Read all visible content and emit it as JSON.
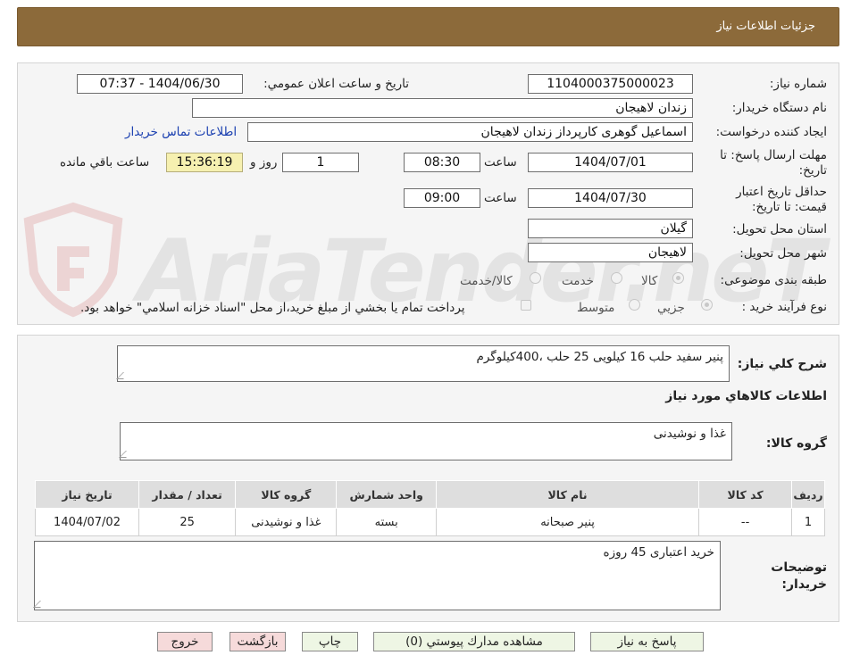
{
  "header": {
    "title": "جزئیات اطلاعات نیاز"
  },
  "form": {
    "need_number": {
      "label": "شماره نیاز:",
      "value": "1104000375000023"
    },
    "announce_datetime": {
      "label": "تاریخ و ساعت اعلان عمومي:",
      "value": "1404/06/30 - 07:37"
    },
    "buyer_org": {
      "label": "نام دستگاه خريدار:",
      "value": "زندان لاهيجان"
    },
    "requester": {
      "label": "ايجاد كننده درخواست:",
      "value": "اسماعیل گوهری کارپرداز زندان لاهیجان"
    },
    "contact_link": "اطلاعات تماس خريدار",
    "deadline": {
      "label_line1": "مهلت ارسال پاسخ: تا",
      "label_line2": "تاريخ:",
      "date": "1404/07/01",
      "time_label": "ساعت",
      "time": "08:30",
      "days": "1",
      "days_label": "روز و",
      "remaining": "15:36:19",
      "remaining_label": "ساعت باقي مانده"
    },
    "price_validity": {
      "label_line1": "حداقل تاريخ اعتبار",
      "label_line2": "قيمت: تا تاريخ:",
      "date": "1404/07/30",
      "time_label": "ساعت",
      "time": "09:00"
    },
    "province": {
      "label": "استان محل تحويل:",
      "value": "گيلان"
    },
    "city": {
      "label": "شهر محل تحويل:",
      "value": "لاهيجان"
    },
    "category": {
      "label": "طبقه بندی موضوعی:",
      "options": [
        "کالا",
        "خدمت",
        "کالا/خدمت"
      ],
      "selected": 0
    },
    "purchase_process": {
      "label": "نوع فرآیند خرید :",
      "options": [
        "جزيي",
        "متوسط"
      ],
      "selected": 0,
      "treasury_note": "پرداخت تمام يا بخشي از مبلغ خريد،از محل \"اسناد خزانه اسلامي\" خواهد بود."
    }
  },
  "summary": {
    "label": "شرح كلي نياز:",
    "value": "پنیر سفید حلب 16 کیلویی 25 حلب ،400کیلوگرم"
  },
  "goods_section": {
    "title": "اطلاعات كالاهاي مورد نياز",
    "group_label": "گروه كالا:",
    "group_value": "غذا و نوشیدنی"
  },
  "table": {
    "headers": [
      "رديف",
      "كد كالا",
      "نام كالا",
      "واحد شمارش",
      "گروه كالا",
      "تعداد / مقدار",
      "تاريخ نياز"
    ],
    "rows": [
      [
        "1",
        "--",
        "پنیر صبحانه",
        "بسته",
        "غذا و نوشیدنی",
        "25",
        "1404/07/02"
      ]
    ]
  },
  "buyer_notes": {
    "label_line1": "توضيحات",
    "label_line2": "خريدار:",
    "value": "خرید اعتباری 45 روزه"
  },
  "buttons": {
    "reply": "پاسخ به نياز",
    "attachments": "مشاهده مدارك پيوستي (0)",
    "print": "چاپ",
    "back": "بازگشت",
    "exit": "خروج"
  },
  "watermark": "AriaTender.neT",
  "colors": {
    "header_bg": "#8c6a3a",
    "link": "#1a3fb0",
    "remaining_bg": "#f6f0b0"
  }
}
